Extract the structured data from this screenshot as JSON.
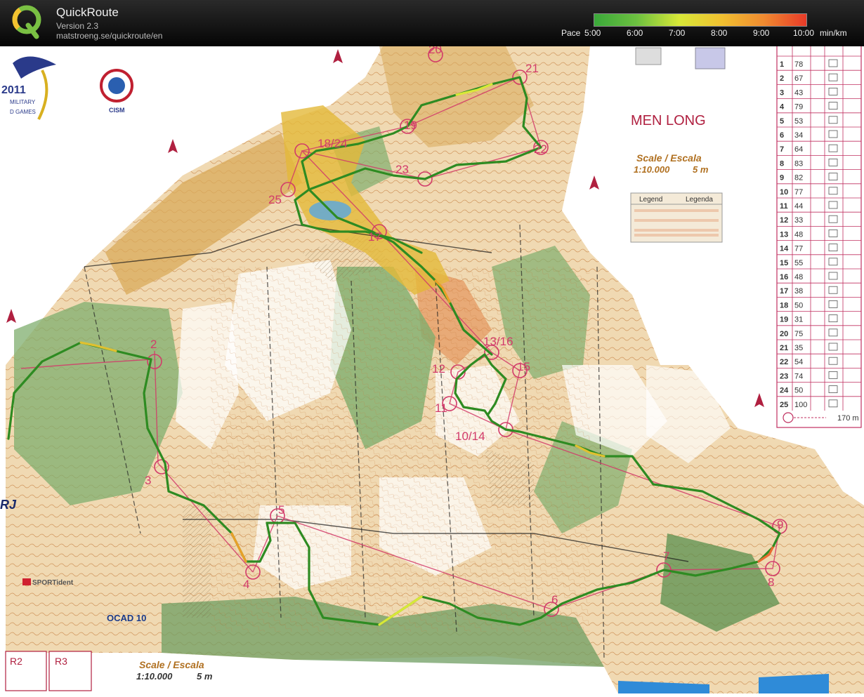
{
  "app": {
    "title": "QuickRoute",
    "version": "Version 2.3",
    "url": "matstroeng.se/quickroute/en"
  },
  "pace_legend": {
    "label": "Pace",
    "ticks": [
      "5:00",
      "6:00",
      "7:00",
      "8:00",
      "9:00",
      "10:00"
    ],
    "unit": "min/km",
    "colors": [
      "#3aa83a",
      "#6cc040",
      "#d8e838",
      "#f0c030",
      "#f08a30",
      "#e83a28"
    ]
  },
  "map": {
    "course_title": "MEN LONG",
    "scale_title": "Scale / Escala",
    "scale_value": "1:10.000",
    "contour": "5 m",
    "scale_title_bottom": "Scale / Escala",
    "scale_value_bottom": "1:10.000",
    "contour_bottom": "5 m",
    "ocad_label": "OCAD 10",
    "sportident_label": "SPORTident",
    "cism_label": "CISM",
    "games_year": "2011",
    "games_line1": "MILITARY",
    "games_line2": "D GAMES",
    "rj_label": "RJ",
    "legend_title_en": "Legend",
    "legend_title_pt": "Legenda",
    "relay_boxes": [
      "R2",
      "R3"
    ],
    "control_labels": [
      "2",
      "3",
      "4",
      "5",
      "6",
      "7",
      "8",
      "9",
      "10/14",
      "11",
      "12",
      "13/16",
      "15",
      "17",
      "18/24",
      "19",
      "20",
      "21",
      "22",
      "23",
      "25"
    ],
    "colors": {
      "route_green": "#2e8b22",
      "course_line": "#d23b6a",
      "forest": "#7fae6e",
      "open": "#d9a95a"
    }
  },
  "control_table": {
    "rows": [
      {
        "n": "1",
        "code": "78"
      },
      {
        "n": "2",
        "code": "67"
      },
      {
        "n": "3",
        "code": "43"
      },
      {
        "n": "4",
        "code": "79"
      },
      {
        "n": "5",
        "code": "53"
      },
      {
        "n": "6",
        "code": "34"
      },
      {
        "n": "7",
        "code": "64"
      },
      {
        "n": "8",
        "code": "83"
      },
      {
        "n": "9",
        "code": "82"
      },
      {
        "n": "10",
        "code": "77"
      },
      {
        "n": "11",
        "code": "44"
      },
      {
        "n": "12",
        "code": "33"
      },
      {
        "n": "13",
        "code": "48"
      },
      {
        "n": "14",
        "code": "77"
      },
      {
        "n": "15",
        "code": "55"
      },
      {
        "n": "16",
        "code": "48"
      },
      {
        "n": "17",
        "code": "38"
      },
      {
        "n": "18",
        "code": "50"
      },
      {
        "n": "19",
        "code": "31"
      },
      {
        "n": "20",
        "code": "75"
      },
      {
        "n": "21",
        "code": "35"
      },
      {
        "n": "22",
        "code": "54"
      },
      {
        "n": "23",
        "code": "74"
      },
      {
        "n": "24",
        "code": "50"
      },
      {
        "n": "25",
        "code": "100"
      }
    ],
    "finish_distance": "170 m"
  }
}
